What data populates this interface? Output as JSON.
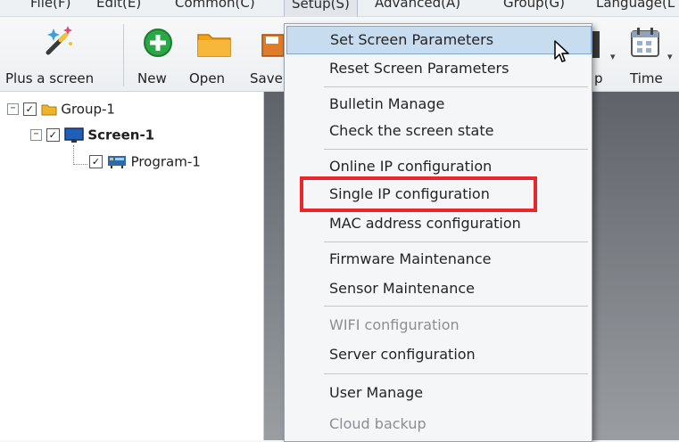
{
  "menubar": {
    "items": [
      "File(F)",
      "Edit(E)",
      "Common(C)",
      "Setup(S)",
      "Advanced(A)",
      "Group(G)",
      "Language(L"
    ]
  },
  "toolbar": {
    "buttons": [
      {
        "label": "Plus a screen",
        "icon": "magic-wand-icon"
      },
      {
        "label": "New",
        "icon": "plus-circle-icon"
      },
      {
        "label": "Open",
        "icon": "folder-icon"
      },
      {
        "label": "Save",
        "icon": "save-icon"
      },
      {
        "label": "p",
        "icon": "partial-icon"
      },
      {
        "label": "Time",
        "icon": "calendar-icon"
      }
    ]
  },
  "tree": {
    "group": {
      "label": "Group-1",
      "expander": "−",
      "checked": true
    },
    "screen": {
      "label": "Screen-1",
      "expander": "−",
      "checked": true
    },
    "program": {
      "label": "Program-1",
      "checked": true
    }
  },
  "setup_menu": {
    "items": [
      {
        "label": "Set Screen Parameters",
        "state": "hover"
      },
      {
        "label": "Reset Screen Parameters",
        "state": "normal"
      },
      {
        "label": "Bulletin Manage",
        "state": "normal"
      },
      {
        "label": "Check the screen state",
        "state": "normal"
      },
      {
        "label": "Online IP configuration",
        "state": "normal"
      },
      {
        "label": "Single IP configuration",
        "state": "highlighted"
      },
      {
        "label": "MAC address configuration",
        "state": "normal"
      },
      {
        "label": "Firmware Maintenance",
        "state": "normal"
      },
      {
        "label": "Sensor Maintenance",
        "state": "normal"
      },
      {
        "label": "WIFI configuration",
        "state": "disabled"
      },
      {
        "label": "Server configuration",
        "state": "normal"
      },
      {
        "label": "User Manage",
        "state": "normal"
      },
      {
        "label": "Cloud backup",
        "state": "disabled"
      }
    ]
  },
  "colors": {
    "highlight_box": "#e8262b",
    "hover_bg": "#c8dcf0",
    "workspace": "#6e7278",
    "new_button_green": "#2aa845",
    "folder_orange": "#f0a21a"
  }
}
